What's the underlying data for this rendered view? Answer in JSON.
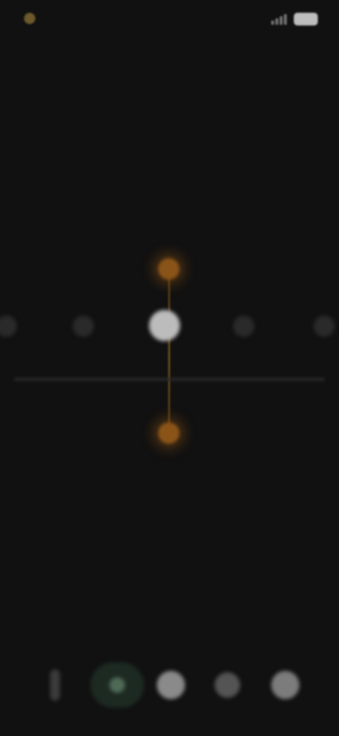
{
  "status_bar": {
    "left_text": "",
    "right_icons": [
      "signal-icon",
      "wifi-icon",
      "battery-icon"
    ]
  },
  "header": {
    "title": "",
    "subtitle": ""
  },
  "picker": {
    "selected_index": 2,
    "stops_count": 5
  },
  "readout": {
    "value": "",
    "caption": ""
  },
  "dock": {
    "buttons": [
      {
        "icon": "torch-icon"
      },
      {
        "icon": "mode-icon",
        "active": true
      },
      {
        "icon": "shutter-icon"
      },
      {
        "icon": "circle-icon"
      },
      {
        "icon": "preview-icon"
      }
    ]
  },
  "colors": {
    "background": "#111111",
    "accent": "#8a5418",
    "active_stop": "#bcbcbc"
  }
}
